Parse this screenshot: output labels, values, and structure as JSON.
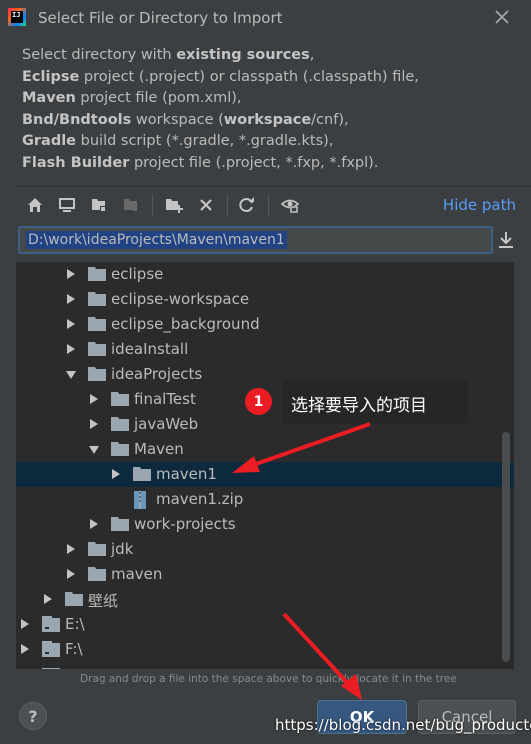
{
  "window": {
    "title": "Select File or Directory to Import",
    "logo_text": "IJ"
  },
  "description": {
    "line1_a": "Select directory with ",
    "line1_b": "existing sources",
    "line1_c": ",",
    "line2_a": "Eclipse",
    "line2_b": " project (.project) or classpath (.classpath) file,",
    "line3_a": "Maven",
    "line3_b": " project file (pom.xml),",
    "line4_a": "Bnd/Bndtools",
    "line4_b": " workspace (",
    "line4_c": "workspace",
    "line4_d": "/cnf),",
    "line5_a": "Gradle",
    "line5_b": " build script (*.gradle, *.gradle.kts),",
    "line6_a": "Flash Builder",
    "line6_b": " project file (.project, *.fxp, *.fxpl)."
  },
  "toolbar": {
    "icons": [
      "home-icon",
      "desktop-icon",
      "project-icon",
      "module-icon",
      "new-folder-icon",
      "delete-icon",
      "refresh-icon",
      "show-hidden-icon"
    ],
    "hide_path_label": "Hide path"
  },
  "path": {
    "value": "D:\\work\\ideaProjects\\Maven\\maven1"
  },
  "tree": {
    "rows": [
      {
        "label": "eclipse",
        "type": "folder",
        "expanded": false
      },
      {
        "label": "eclipse-workspace",
        "type": "folder",
        "expanded": false
      },
      {
        "label": "eclipse_background",
        "type": "folder",
        "expanded": false
      },
      {
        "label": "ideaInstall",
        "type": "folder",
        "expanded": false
      },
      {
        "label": "ideaProjects",
        "type": "folder",
        "expanded": true
      },
      {
        "label": "finalTest",
        "type": "folder",
        "expanded": false
      },
      {
        "label": "javaWeb",
        "type": "folder",
        "expanded": false
      },
      {
        "label": "Maven",
        "type": "folder",
        "expanded": true
      },
      {
        "label": "maven1",
        "type": "folder",
        "expanded": false,
        "selected": true
      },
      {
        "label": "maven1.zip",
        "type": "zip"
      },
      {
        "label": "work-projects",
        "type": "folder",
        "expanded": false
      },
      {
        "label": "jdk",
        "type": "folder",
        "expanded": false
      },
      {
        "label": "maven",
        "type": "folder",
        "expanded": false
      },
      {
        "label": "壁纸",
        "type": "folder",
        "expanded": false
      },
      {
        "label": "E:\\",
        "type": "drive",
        "expanded": false
      },
      {
        "label": "F:\\",
        "type": "drive",
        "expanded": false
      }
    ]
  },
  "annotation": {
    "badge": "1",
    "callout": "选择要导入的项目"
  },
  "hint": "Drag and drop a file into the space above to quickly locate it in the tree",
  "buttons": {
    "help": "?",
    "ok": "OK",
    "cancel": "Cancel"
  },
  "watermark": "https://blog.csdn.net/bug_producter",
  "colors": {
    "background": "#3c3f41",
    "tree_background": "#2b2b2b",
    "selection": "#0d293e",
    "link": "#589df6",
    "annotation_red": "#ec1c24"
  }
}
